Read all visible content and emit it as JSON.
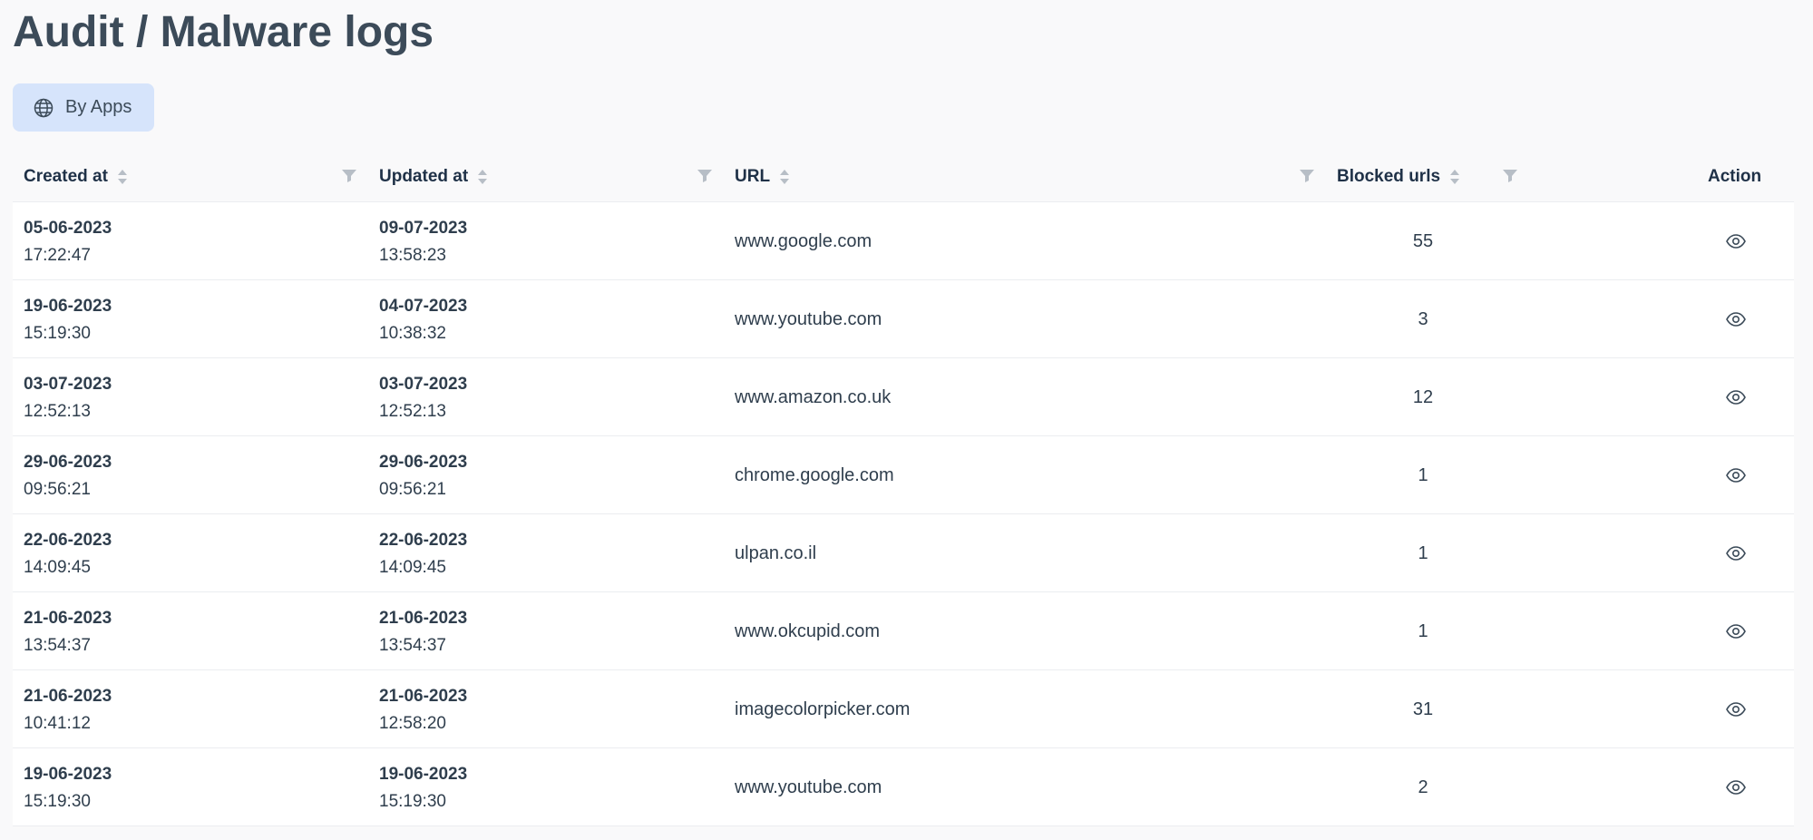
{
  "page": {
    "title": "Audit / Malware logs"
  },
  "view_toggle": {
    "label": "By Apps",
    "icon": "globe-icon"
  },
  "table": {
    "columns": {
      "created_at": "Created at",
      "updated_at": "Updated at",
      "url": "URL",
      "blocked_urls": "Blocked urls",
      "action": "Action"
    },
    "rows": [
      {
        "created_date": "05-06-2023",
        "created_time": "17:22:47",
        "updated_date": "09-07-2023",
        "updated_time": "13:58:23",
        "url": "www.google.com",
        "blocked": "55"
      },
      {
        "created_date": "19-06-2023",
        "created_time": "15:19:30",
        "updated_date": "04-07-2023",
        "updated_time": "10:38:32",
        "url": "www.youtube.com",
        "blocked": "3"
      },
      {
        "created_date": "03-07-2023",
        "created_time": "12:52:13",
        "updated_date": "03-07-2023",
        "updated_time": "12:52:13",
        "url": "www.amazon.co.uk",
        "blocked": "12"
      },
      {
        "created_date": "29-06-2023",
        "created_time": "09:56:21",
        "updated_date": "29-06-2023",
        "updated_time": "09:56:21",
        "url": "chrome.google.com",
        "blocked": "1"
      },
      {
        "created_date": "22-06-2023",
        "created_time": "14:09:45",
        "updated_date": "22-06-2023",
        "updated_time": "14:09:45",
        "url": "ulpan.co.il",
        "blocked": "1"
      },
      {
        "created_date": "21-06-2023",
        "created_time": "13:54:37",
        "updated_date": "21-06-2023",
        "updated_time": "13:54:37",
        "url": "www.okcupid.com",
        "blocked": "1"
      },
      {
        "created_date": "21-06-2023",
        "created_time": "10:41:12",
        "updated_date": "21-06-2023",
        "updated_time": "12:58:20",
        "url": "imagecolorpicker.com",
        "blocked": "31"
      },
      {
        "created_date": "19-06-2023",
        "created_time": "15:19:30",
        "updated_date": "19-06-2023",
        "updated_time": "15:19:30",
        "url": "www.youtube.com",
        "blocked": "2"
      }
    ]
  },
  "colors": {
    "accent_bg": "#d6e4fb",
    "title": "#3c4b59",
    "header_text": "#1f3147",
    "icon": "#9aa3ad"
  }
}
